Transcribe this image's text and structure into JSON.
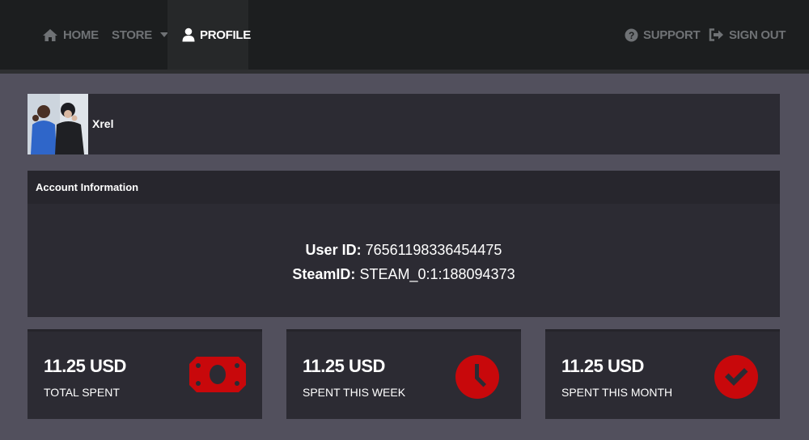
{
  "nav": {
    "home": "HOME",
    "store": "STORE",
    "profile": "PROFILE",
    "support": "SUPPORT",
    "signout": "SIGN OUT"
  },
  "profile": {
    "username": "Xrel"
  },
  "account": {
    "heading": "Account Information",
    "user_id_label": "User ID:",
    "user_id": "76561198336454475",
    "steam_id_label": "SteamID:",
    "steam_id": "STEAM_0:1:188094373"
  },
  "stats": [
    {
      "amount": "11.25 USD",
      "label": "TOTAL SPENT",
      "icon": "money-bill-icon"
    },
    {
      "amount": "11.25 USD",
      "label": "SPENT THIS WEEK",
      "icon": "clock-icon"
    },
    {
      "amount": "11.25 USD",
      "label": "SPENT THIS MONTH",
      "icon": "check-circle-icon"
    }
  ],
  "colors": {
    "accent": "#c8080b",
    "background": "#52505d",
    "panel": "#2c2b33",
    "navbar": "#1c1e1f"
  }
}
